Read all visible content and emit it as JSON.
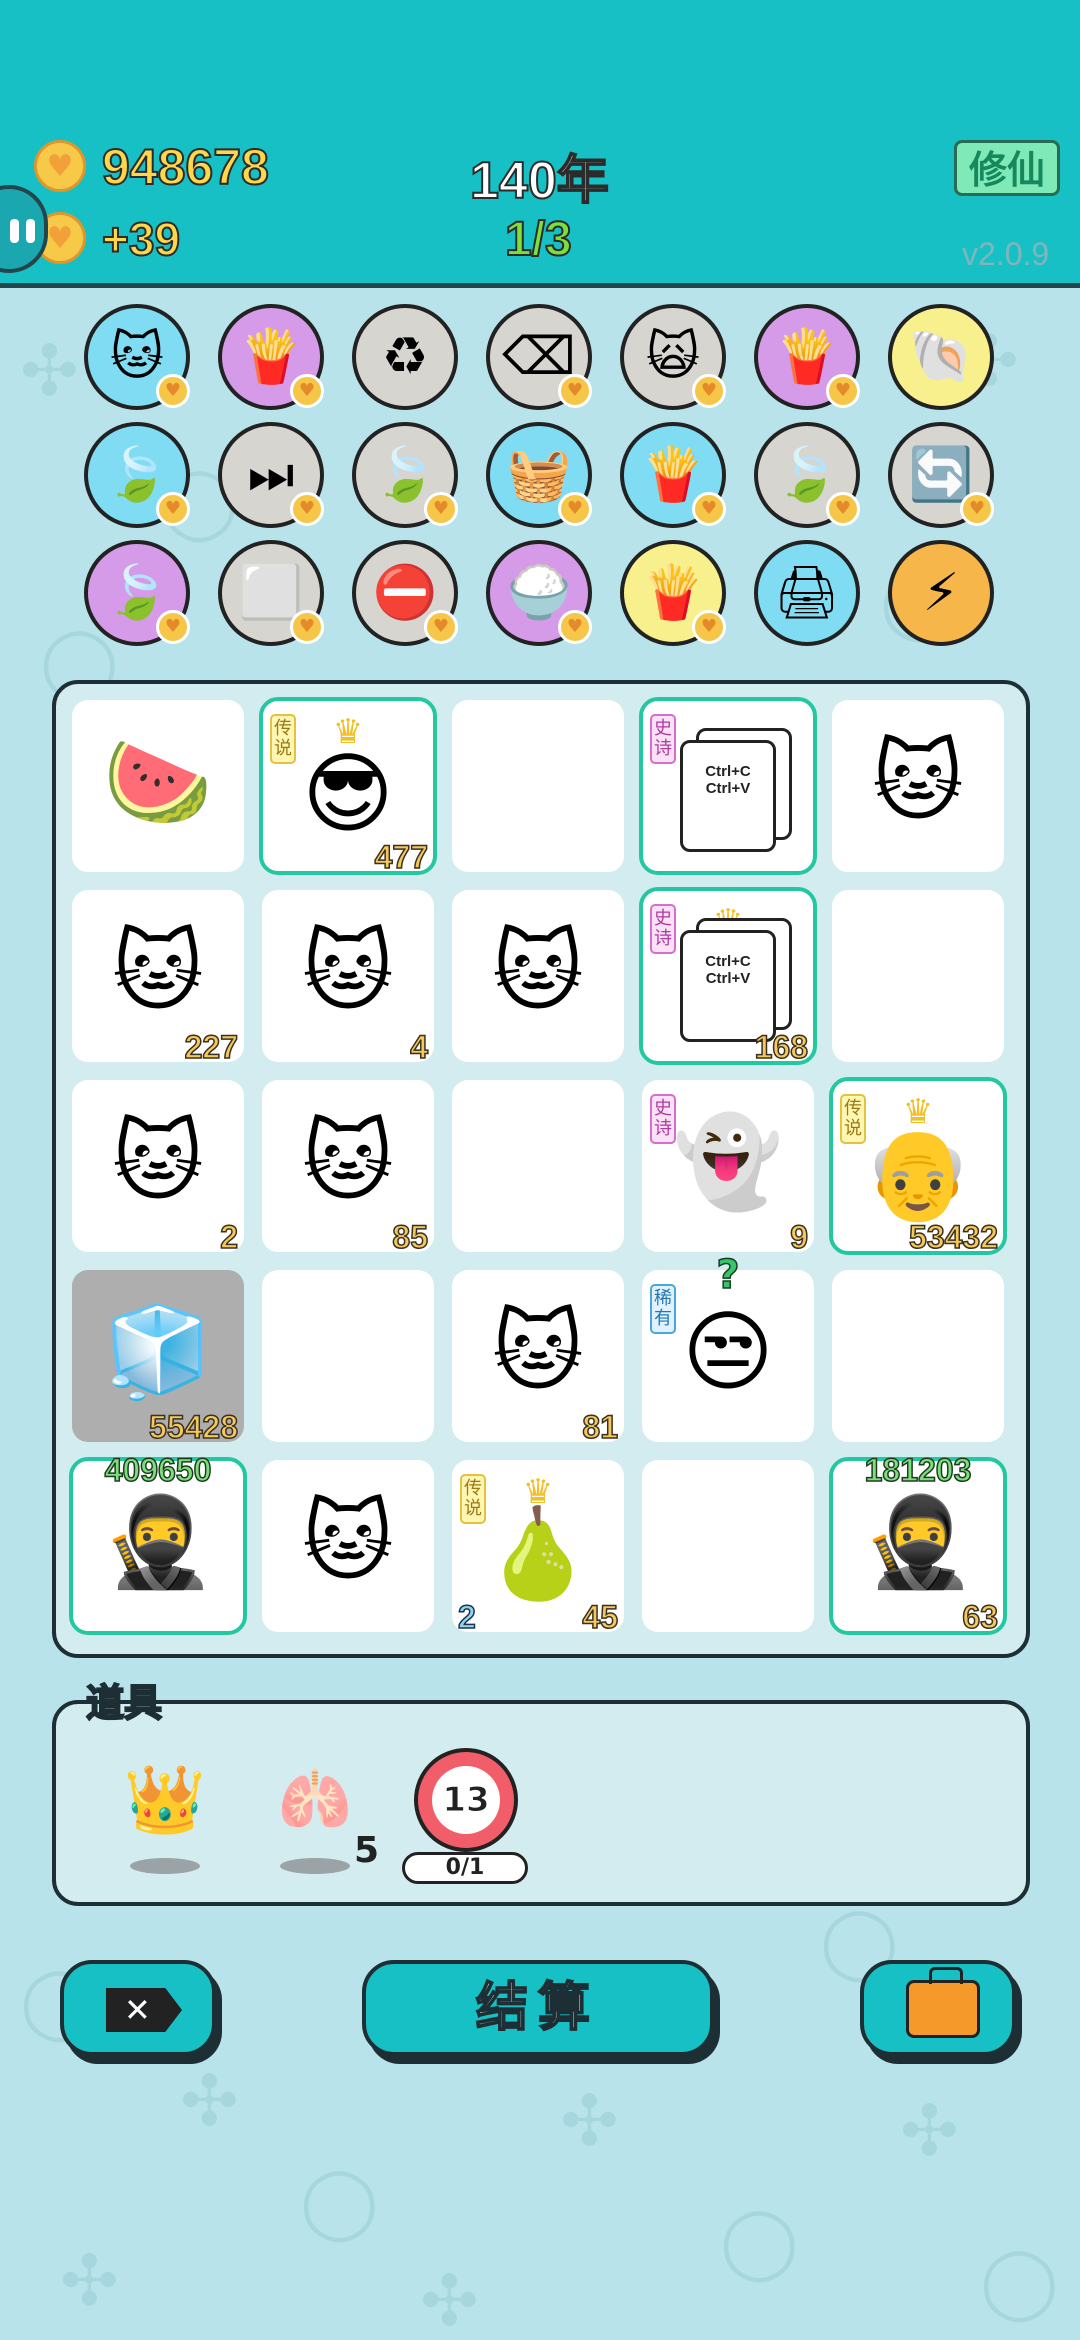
{
  "header": {
    "coins": "948678",
    "income": "+39",
    "year": "140年",
    "round": "1/3",
    "mode_button": "修仙",
    "version": "v2.0.9"
  },
  "relics": [
    {
      "icon": "cat-icon",
      "glyph": "🐱",
      "bg": "blue"
    },
    {
      "icon": "fries-icon",
      "glyph": "🍟",
      "bg": "purple"
    },
    {
      "icon": "recycle-icon",
      "glyph": "♻",
      "bg": "gray"
    },
    {
      "icon": "delete-tag-icon",
      "glyph": "⌫",
      "bg": "gray"
    },
    {
      "icon": "cat-eyes-icon",
      "glyph": "🙀",
      "bg": "gray"
    },
    {
      "icon": "fries-icon",
      "glyph": "🍟",
      "bg": "purple"
    },
    {
      "icon": "shell-icon",
      "glyph": "🐚",
      "bg": "yellow"
    },
    {
      "icon": "leaf-icon",
      "glyph": "🍃",
      "bg": "blue"
    },
    {
      "icon": "skip-icon",
      "glyph": "⏭",
      "bg": "gray"
    },
    {
      "icon": "leaf-icon",
      "glyph": "🍃",
      "bg": "gray"
    },
    {
      "icon": "fruit-basket-icon",
      "glyph": "🧺",
      "bg": "blue"
    },
    {
      "icon": "fries-icon",
      "glyph": "🍟",
      "bg": "blue"
    },
    {
      "icon": "leaf-icon",
      "glyph": "🍃",
      "bg": "gray"
    },
    {
      "icon": "refresh-icon",
      "glyph": "🔄",
      "bg": "gray"
    },
    {
      "icon": "leaf-icon",
      "glyph": "🍃",
      "bg": "purple"
    },
    {
      "icon": "sugar-cubes-icon",
      "glyph": "⬜",
      "bg": "gray"
    },
    {
      "icon": "no-entry-icon",
      "glyph": "⛔",
      "bg": "gray"
    },
    {
      "icon": "rice-bowl-icon",
      "glyph": "🍚",
      "bg": "purple"
    },
    {
      "icon": "fries-icon",
      "glyph": "🍟",
      "bg": "yellow"
    },
    {
      "icon": "printer-icon",
      "glyph": "🖨",
      "bg": "blue"
    },
    {
      "icon": "lightning-icon",
      "glyph": "⚡",
      "bg": "orange"
    }
  ],
  "board": {
    "cells": [
      {
        "icon": "watermelon-icon",
        "glyph": "🍉"
      },
      {
        "icon": "king-sunglasses-icon",
        "glyph": "😎",
        "tag": "传说",
        "tagType": "legend",
        "crown": true,
        "num": "477",
        "hl": true
      },
      {
        "icon": "empty",
        "glyph": ""
      },
      {
        "icon": "copy-paste-icon",
        "card": "Ctrl+C Ctrl+V",
        "tag": "史诗",
        "tagType": "epic",
        "hl": true
      },
      {
        "icon": "cat-icon",
        "glyph": "🐱"
      },
      {
        "icon": "cat-icon",
        "glyph": "🐱",
        "num": "227"
      },
      {
        "icon": "cat-icon",
        "glyph": "🐱",
        "num": "4"
      },
      {
        "icon": "cat-icon",
        "glyph": "🐱"
      },
      {
        "icon": "copy-paste-icon",
        "card": "Ctrl+C Ctrl+V",
        "tag": "史诗",
        "tagType": "epic",
        "crown": true,
        "num": "168",
        "hl": true
      },
      {
        "icon": "empty",
        "glyph": ""
      },
      {
        "icon": "cat-icon",
        "glyph": "🐱",
        "num": "2"
      },
      {
        "icon": "cat-icon",
        "glyph": "🐱",
        "num": "85"
      },
      {
        "icon": "empty",
        "glyph": ""
      },
      {
        "icon": "ghost-icon",
        "glyph": "👻",
        "tag": "史诗",
        "tagType": "epic",
        "num": "9"
      },
      {
        "icon": "old-king-icon",
        "glyph": "👴",
        "tag": "传说",
        "tagType": "legend",
        "crown": true,
        "num": "53432",
        "hl": true
      },
      {
        "icon": "fridge-icon",
        "glyph": "🧊",
        "num": "55428",
        "gray": true
      },
      {
        "icon": "empty",
        "glyph": ""
      },
      {
        "icon": "cat-icon",
        "glyph": "🐱",
        "num": "81"
      },
      {
        "icon": "bucket-hat-man-icon",
        "glyph": "😒",
        "tag": "稀有",
        "tagType": "rare",
        "qmark": "?"
      },
      {
        "icon": "empty",
        "glyph": ""
      },
      {
        "icon": "thief-icon",
        "glyph": "🥷",
        "topnum": "409650",
        "hl": true
      },
      {
        "icon": "cat-icon",
        "glyph": "🐱"
      },
      {
        "icon": "golden-pear-icon",
        "glyph": "🍐",
        "tag": "传说",
        "tagType": "legend",
        "crown": true,
        "leftnum": "2",
        "num": "45"
      },
      {
        "icon": "empty",
        "glyph": ""
      },
      {
        "icon": "thief-icon",
        "glyph": "🥷",
        "topnum": "181203",
        "num": "63",
        "hl": true
      }
    ]
  },
  "props": {
    "label": "道具",
    "items": [
      {
        "icon": "crown-icon",
        "glyph": "👑"
      },
      {
        "icon": "liver-icon",
        "glyph": "🫁",
        "count": "5"
      },
      {
        "icon": "target-icon",
        "value": "13",
        "progress": "0/1"
      }
    ]
  },
  "buttons": {
    "settle": "结算",
    "exit_glyph": "✕"
  },
  "colors": {
    "topbar": "#17c0c4",
    "background": "#b9e3ea",
    "coin": "#ffd84a",
    "highlight": "#24c8a0"
  }
}
